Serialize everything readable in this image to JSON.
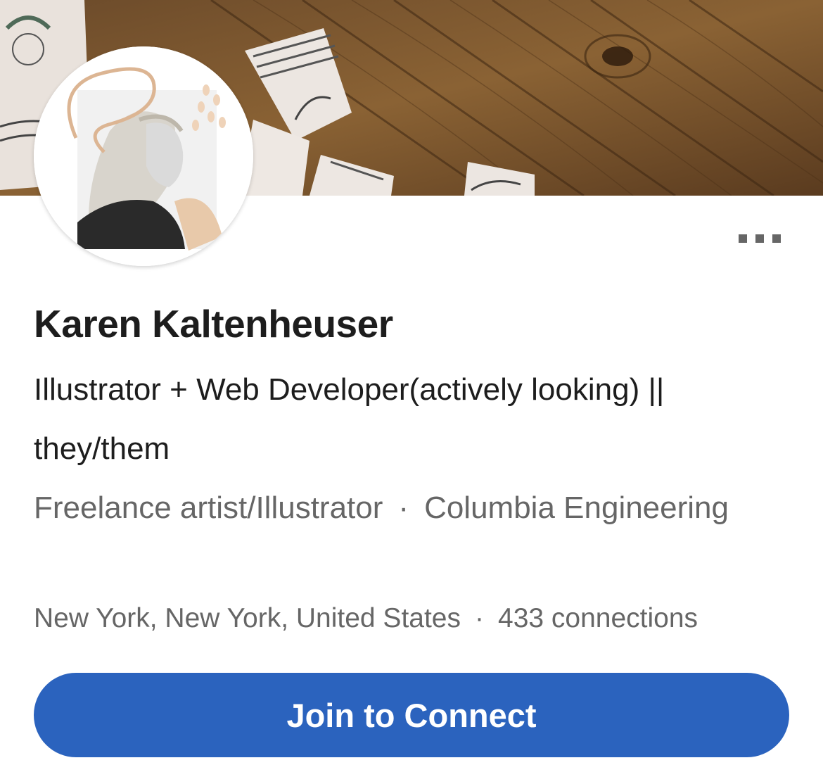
{
  "profile": {
    "name": "Karen Kaltenheuser",
    "headline": "Illustrator + Web Developer(actively looking) || they/them",
    "current_position": "Freelance artist/Illustrator",
    "separator": "·",
    "education": "Columbia Engineering",
    "location": "New York, New York, United States",
    "connections": "433 connections"
  },
  "actions": {
    "join_label": "Join to Connect",
    "more_icon": "more-options-icon"
  },
  "colors": {
    "primary": "#2b63be",
    "text_primary": "#1d1d1d",
    "text_secondary": "#666666"
  }
}
